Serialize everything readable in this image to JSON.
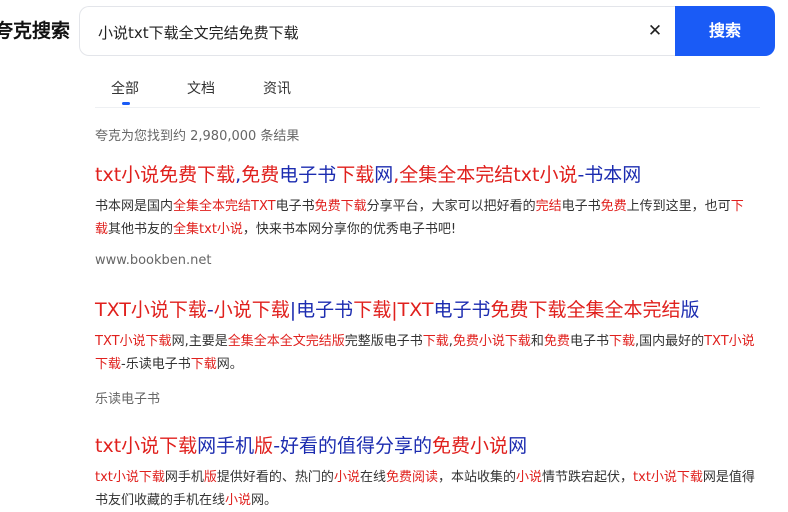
{
  "header": {
    "logo_text": "夸克搜索",
    "search_value": "小说txt下载全文完结免费下载",
    "clear_symbol": "✕",
    "search_button_label": "搜索"
  },
  "tabs": [
    {
      "label": "全部",
      "active": true
    },
    {
      "label": "文档",
      "active": false
    },
    {
      "label": "资讯",
      "active": false
    }
  ],
  "result_count_text": "夸克为您找到约 2,980,000 条结果",
  "colors": {
    "accent": "#1a5bf6",
    "title_link": "#1c2cb0",
    "highlight": "#e0201d"
  },
  "results": [
    {
      "title": [
        {
          "t": "txt小说免费下载",
          "h": true
        },
        {
          "t": ",",
          "h": false
        },
        {
          "t": "免费",
          "h": true
        },
        {
          "t": "电子书",
          "h": false
        },
        {
          "t": "下载",
          "h": true
        },
        {
          "t": "网",
          "h": false
        },
        {
          "t": ",全集全本完结txt小说",
          "h": true
        },
        {
          "t": "-书本网",
          "h": false
        }
      ],
      "snippet": [
        {
          "t": "书本网是国内",
          "h": false
        },
        {
          "t": "全集全本完结TXT",
          "h": true
        },
        {
          "t": "电子书",
          "h": false
        },
        {
          "t": "免费下载",
          "h": true
        },
        {
          "t": "分享平台，大家可以把好看的",
          "h": false
        },
        {
          "t": "完结",
          "h": true
        },
        {
          "t": "电子书",
          "h": false
        },
        {
          "t": "免费",
          "h": true
        },
        {
          "t": "上传到这里，也可",
          "h": false
        },
        {
          "t": "下载",
          "h": true
        },
        {
          "t": "其他书友的",
          "h": false
        },
        {
          "t": "全集txt小说",
          "h": true
        },
        {
          "t": "，快来书本网分享你的优秀电子书吧!",
          "h": false
        }
      ],
      "source": "www.bookben.net"
    },
    {
      "title": [
        {
          "t": "TXT小说下载",
          "h": true
        },
        {
          "t": "-",
          "h": false
        },
        {
          "t": "小说下载",
          "h": true
        },
        {
          "t": "|电子书",
          "h": false
        },
        {
          "t": "下载",
          "h": true
        },
        {
          "t": "|TXT",
          "h": true
        },
        {
          "t": "电子书",
          "h": false
        },
        {
          "t": "免费下载全集全本完结",
          "h": true
        },
        {
          "t": "版",
          "h": false
        }
      ],
      "snippet": [
        {
          "t": "TXT小说下载",
          "h": true
        },
        {
          "t": "网,主要是",
          "h": false
        },
        {
          "t": "全集全本全文完结版",
          "h": true
        },
        {
          "t": "完整版电子书",
          "h": false
        },
        {
          "t": "下载",
          "h": true
        },
        {
          "t": ",",
          "h": false
        },
        {
          "t": "免费小说下载",
          "h": true
        },
        {
          "t": "和",
          "h": false
        },
        {
          "t": "免费",
          "h": true
        },
        {
          "t": "电子书",
          "h": false
        },
        {
          "t": "下载",
          "h": true
        },
        {
          "t": ",国内最好的",
          "h": false
        },
        {
          "t": "TXT小说下载",
          "h": true
        },
        {
          "t": "-乐读电子书",
          "h": false
        },
        {
          "t": "下载",
          "h": true
        },
        {
          "t": "网。",
          "h": false
        }
      ],
      "source": "乐读电子书"
    },
    {
      "title": [
        {
          "t": "txt小说下载",
          "h": true
        },
        {
          "t": "网手机",
          "h": false
        },
        {
          "t": "版",
          "h": true
        },
        {
          "t": "-好看的值得分享的",
          "h": false
        },
        {
          "t": "免费小说",
          "h": true
        },
        {
          "t": "网",
          "h": false
        }
      ],
      "snippet": [
        {
          "t": "txt小说下载",
          "h": true
        },
        {
          "t": "网手机",
          "h": false
        },
        {
          "t": "版",
          "h": true
        },
        {
          "t": "提供好看的、热门的",
          "h": false
        },
        {
          "t": "小说",
          "h": true
        },
        {
          "t": "在线",
          "h": false
        },
        {
          "t": "免费阅读",
          "h": true
        },
        {
          "t": "，本站收集的",
          "h": false
        },
        {
          "t": "小说",
          "h": true
        },
        {
          "t": "情节跌宕起伏，",
          "h": false
        },
        {
          "t": "txt小说下载",
          "h": true
        },
        {
          "t": "网是值得书友们收藏的手机在线",
          "h": false
        },
        {
          "t": "小说",
          "h": true
        },
        {
          "t": "网。",
          "h": false
        }
      ],
      "source": ""
    }
  ]
}
